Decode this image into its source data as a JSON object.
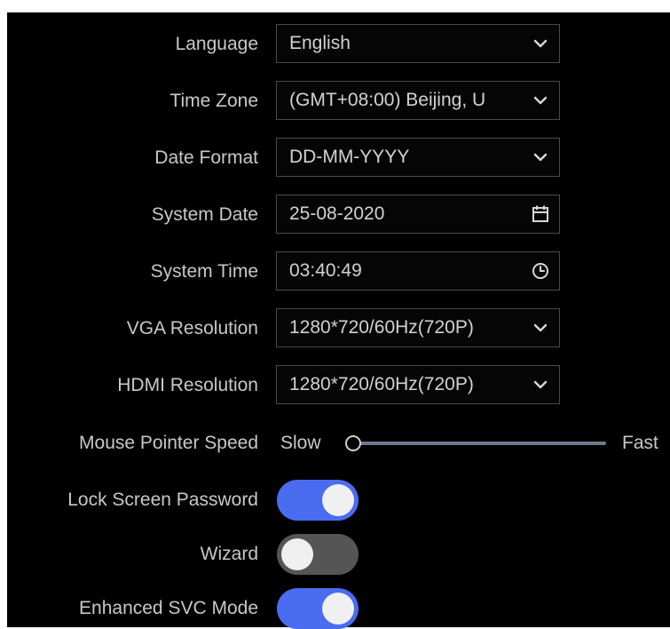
{
  "settings": {
    "language": {
      "label": "Language",
      "value": "English",
      "icon": "chevron-down-icon"
    },
    "time_zone": {
      "label": "Time Zone",
      "value": "(GMT+08:00) Beijing, U",
      "icon": "chevron-down-icon"
    },
    "date_format": {
      "label": "Date Format",
      "value": "DD-MM-YYYY",
      "icon": "chevron-down-icon"
    },
    "system_date": {
      "label": "System Date",
      "value": "25-08-2020",
      "icon": "calendar-icon"
    },
    "system_time": {
      "label": "System Time",
      "value": "03:40:49",
      "icon": "clock-icon"
    },
    "vga_resolution": {
      "label": "VGA Resolution",
      "value": "1280*720/60Hz(720P)",
      "icon": "chevron-down-icon"
    },
    "hdmi_resolution": {
      "label": "HDMI Resolution",
      "value": "1280*720/60Hz(720P)",
      "icon": "chevron-down-icon"
    },
    "mouse_pointer_speed": {
      "label": "Mouse Pointer Speed",
      "min_label": "Slow",
      "max_label": "Fast",
      "level": 0.0
    },
    "lock_screen_password": {
      "label": "Lock Screen Password",
      "enabled": true
    },
    "wizard": {
      "label": "Wizard",
      "enabled": false
    },
    "enhanced_svc_mode": {
      "label": "Enhanced SVC Mode",
      "enabled": true
    }
  },
  "colors": {
    "toggle_on": "#4a6cf0",
    "toggle_off": "#555555",
    "background": "#000000",
    "text": "#c8c8c8"
  }
}
